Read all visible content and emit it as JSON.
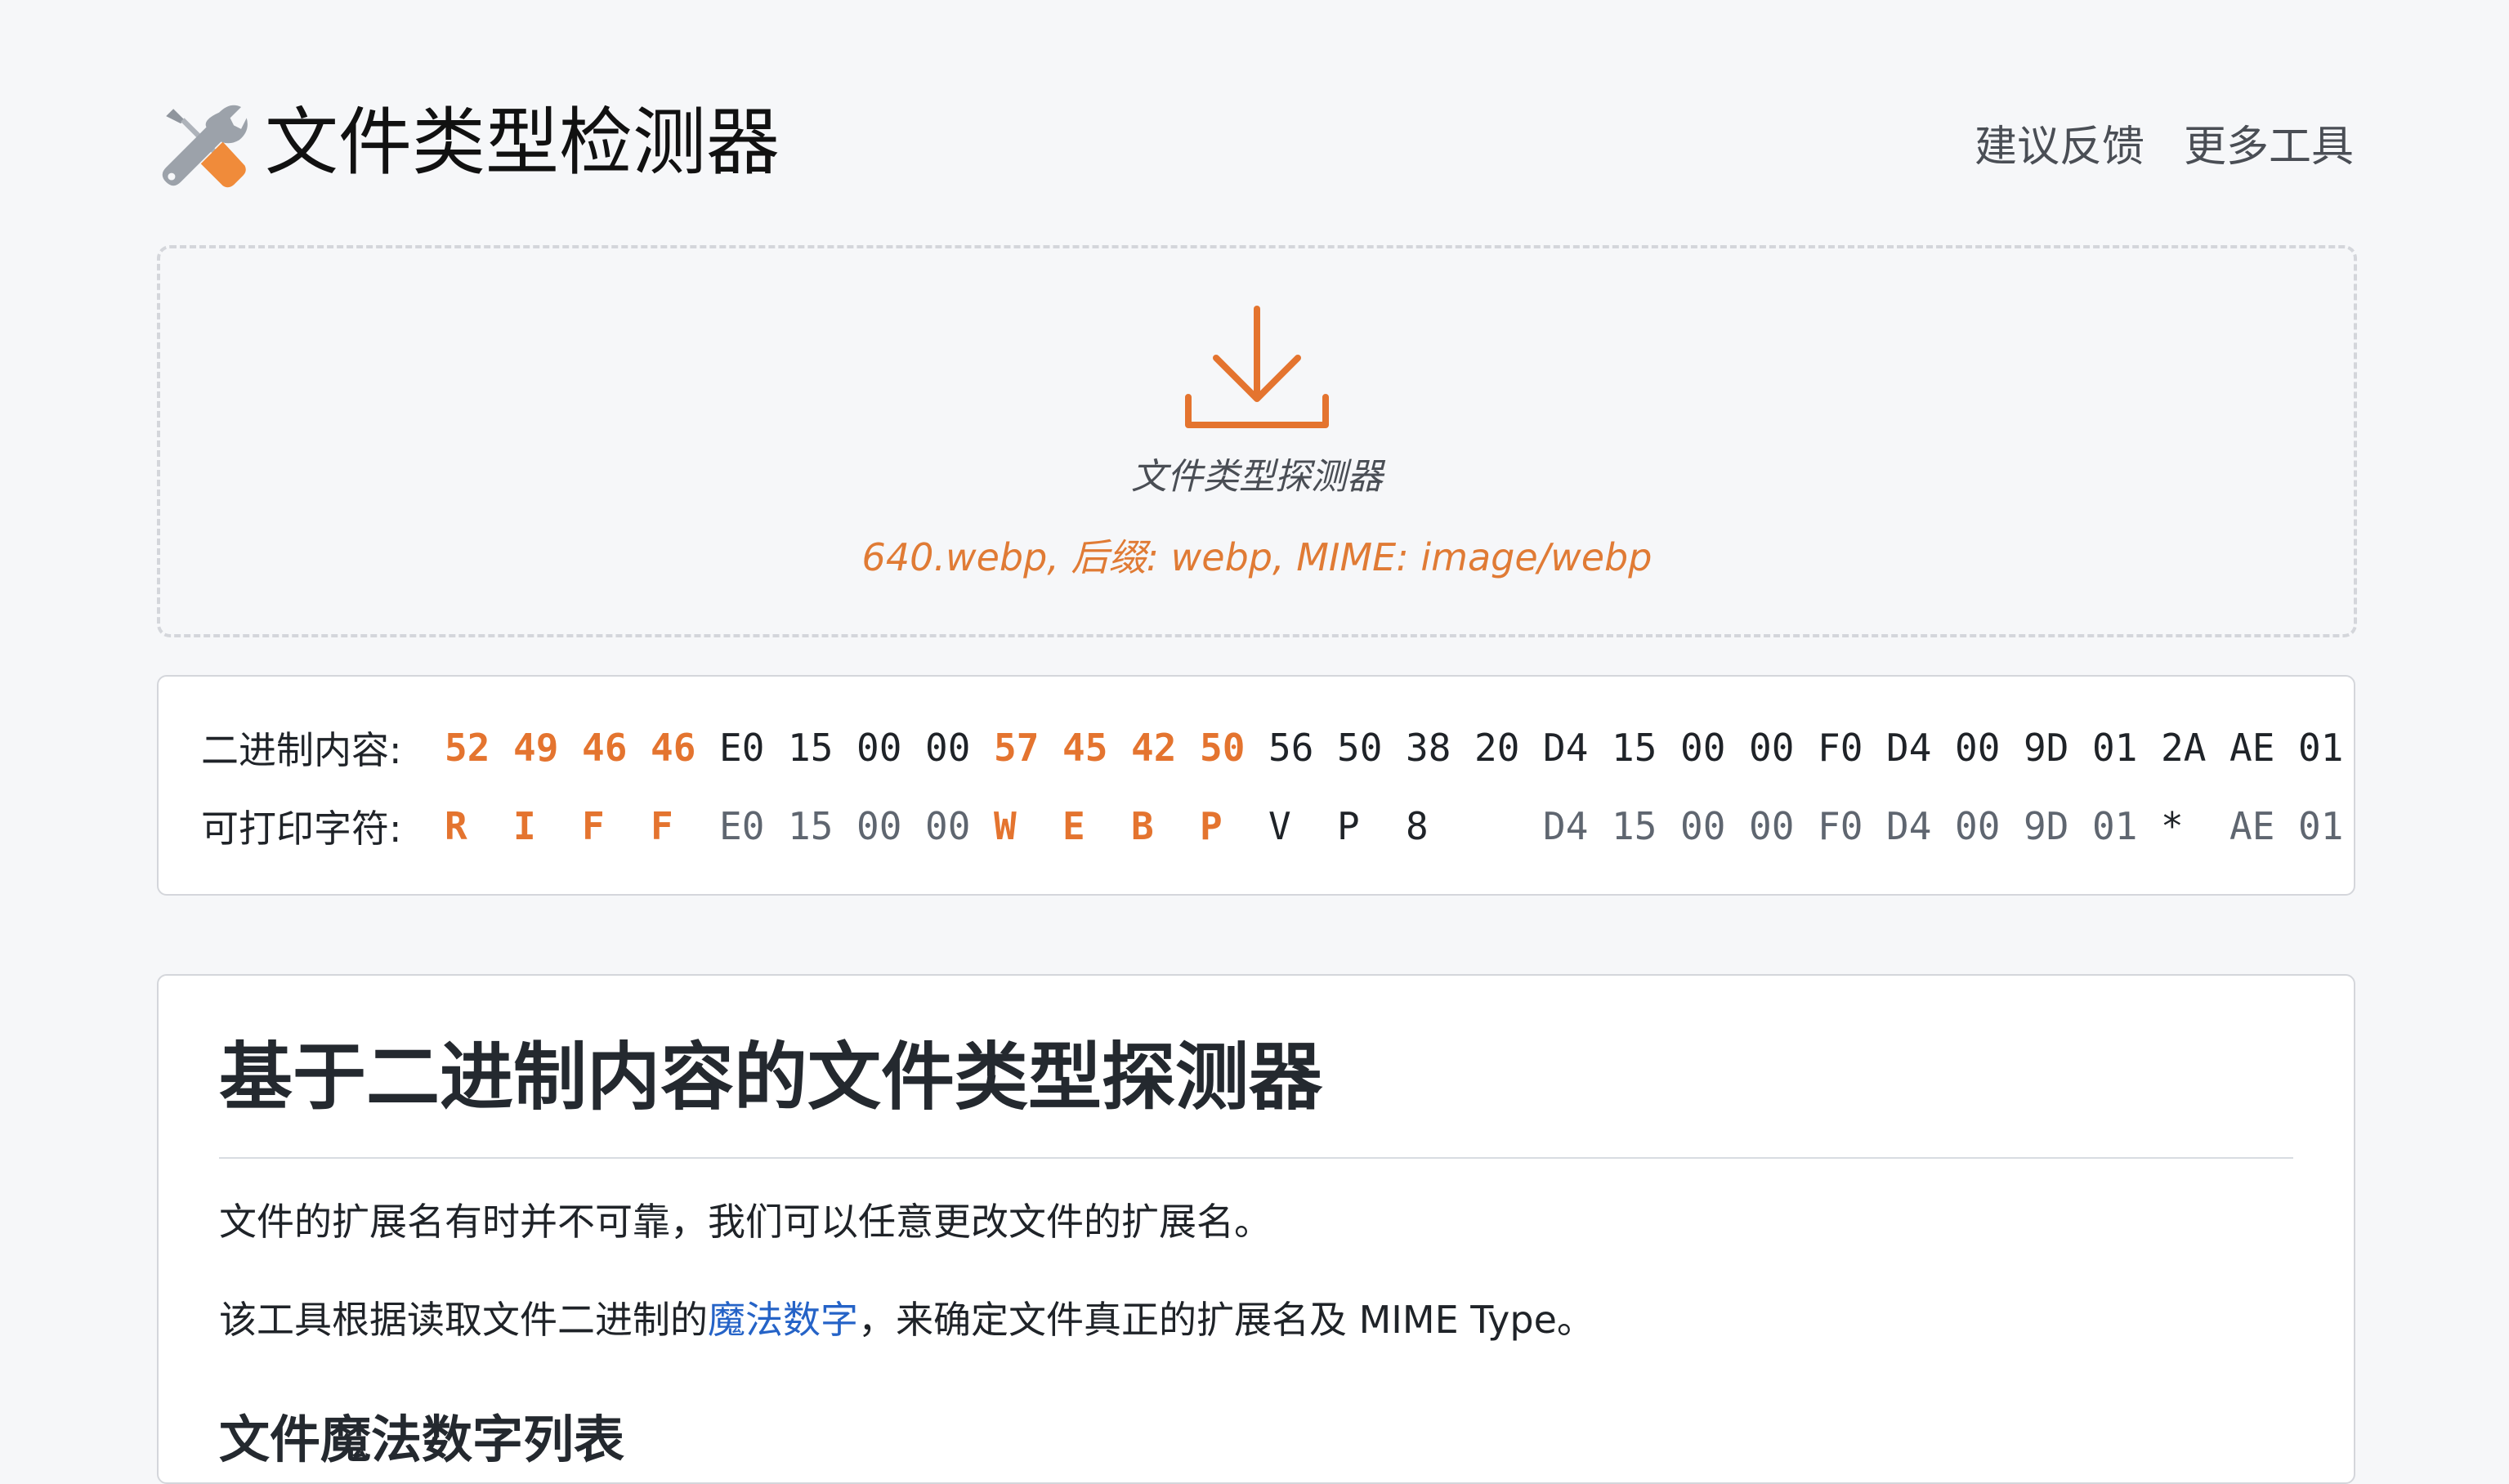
{
  "header": {
    "app_title": "文件类型检测器",
    "logo_icon": "tools-wrench-screwdriver-icon",
    "nav": [
      {
        "label": "建议反馈"
      },
      {
        "label": "更多工具"
      }
    ]
  },
  "dropzone": {
    "icon": "download-icon",
    "label": "文件类型探测器",
    "file_info": "640.webp, 后缀: webp, MIME: image/webp"
  },
  "hex_view": {
    "binary_label": "二进制内容:",
    "printable_label": "可打印字符:",
    "bytes": [
      "52",
      "49",
      "46",
      "46",
      "E0",
      "15",
      "00",
      "00",
      "57",
      "45",
      "42",
      "50",
      "56",
      "50",
      "38",
      "20",
      "D4",
      "15",
      "00",
      "00",
      "F0",
      "D4",
      "00",
      "9D",
      "01",
      "2A",
      "AE",
      "01"
    ],
    "chars": [
      "R",
      "I",
      "F",
      "F",
      "E0",
      "15",
      "00",
      "00",
      "W",
      "E",
      "B",
      "P",
      "V",
      "P",
      "8",
      "",
      "D4",
      "15",
      "00",
      "00",
      "F0",
      "D4",
      "00",
      "9D",
      "01",
      "*",
      "AE",
      "01"
    ],
    "highlight_indices": [
      0,
      1,
      2,
      3,
      8,
      9,
      10,
      11
    ],
    "printable_indices": [
      12,
      13,
      14,
      15,
      25
    ]
  },
  "article": {
    "title": "基于二进制内容的文件类型探测器",
    "paragraph1": "文件的扩展名有时并不可靠，我们可以任意更改文件的扩展名。",
    "paragraph2_before": "该工具根据读取文件二进制的",
    "paragraph2_link": "魔法数字",
    "paragraph2_after": "，来确定文件真正的扩展名及 MIME Type。",
    "subheading": "文件魔法数字列表"
  },
  "colors": {
    "accent": "#e4742f",
    "link": "#2563c7",
    "background": "#f6f7f9"
  }
}
